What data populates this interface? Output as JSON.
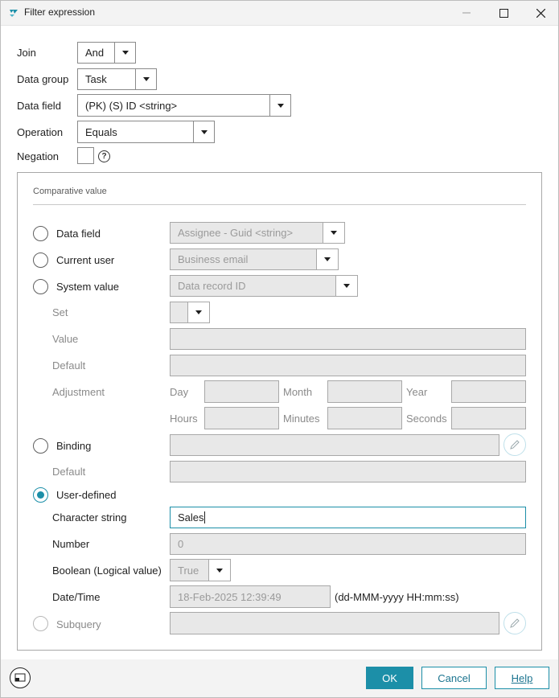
{
  "window": {
    "title": "Filter expression",
    "icon": "filter-app-icon"
  },
  "form": {
    "join_label": "Join",
    "join_value": "And",
    "data_group_label": "Data group",
    "data_group_value": "Task",
    "data_field_label": "Data field",
    "data_field_value": "(PK) (S) ID <string>",
    "operation_label": "Operation",
    "operation_value": "Equals",
    "negation_label": "Negation",
    "negation_help": "?"
  },
  "comparative": {
    "title": "Comparative value",
    "data_field_label": "Data field",
    "data_field_value": "Assignee - Guid <string>",
    "current_user_label": "Current user",
    "current_user_value": "Business email",
    "system_value_label": "System value",
    "system_value_value": "Data record ID",
    "set_label": "Set",
    "value_label": "Value",
    "default_label": "Default",
    "adjustment_label": "Adjustment",
    "day_label": "Day",
    "month_label": "Month",
    "year_label": "Year",
    "hours_label": "Hours",
    "minutes_label": "Minutes",
    "seconds_label": "Seconds",
    "binding_label": "Binding",
    "binding_default_label": "Default",
    "user_defined_label": "User-defined",
    "character_string_label": "Character string",
    "character_string_value": "Sales",
    "number_label": "Number",
    "number_value": "0",
    "boolean_label": "Boolean (Logical value)",
    "boolean_value": "True",
    "datetime_label": "Date/Time",
    "datetime_value": "18-Feb-2025 12:39:49",
    "datetime_format": "(dd-MMM-yyyy HH:mm:ss)",
    "subquery_label": "Subquery"
  },
  "buttons": {
    "ok": "OK",
    "cancel": "Cancel",
    "help": "Help"
  },
  "colors": {
    "accent": "#1c8fa8",
    "disabled_fill": "#e8e8e8"
  }
}
